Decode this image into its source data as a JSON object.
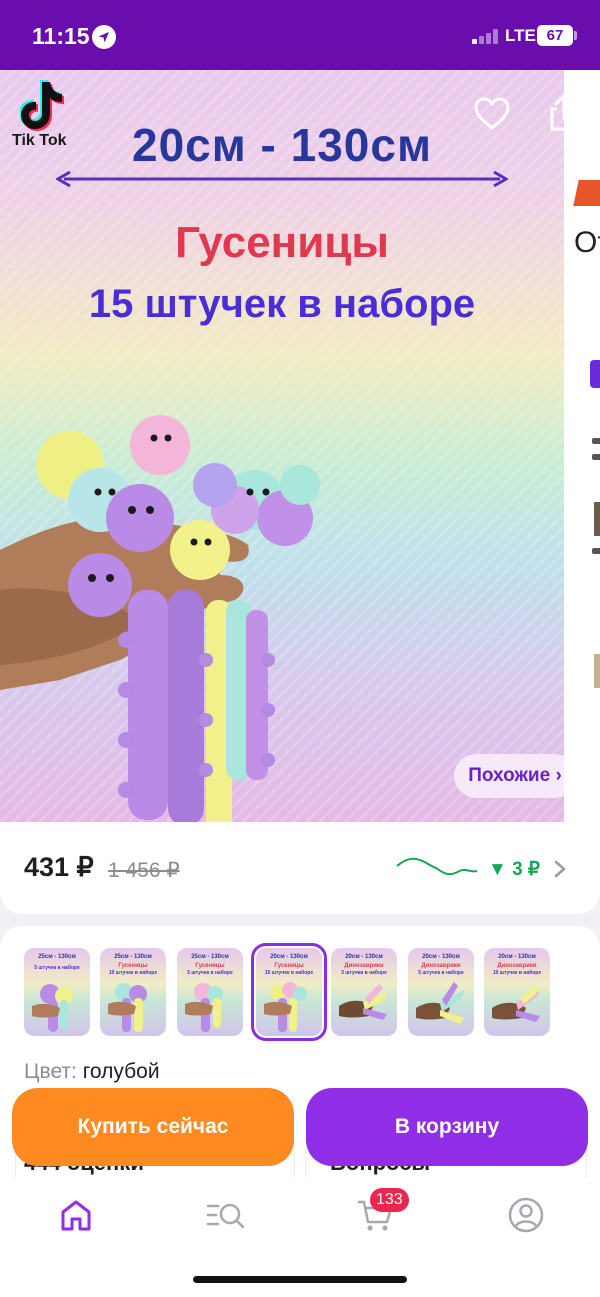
{
  "status_bar": {
    "time": "11:15",
    "network": "LTE",
    "battery": "67"
  },
  "product_image": {
    "brand_label": "Tik Tok",
    "size_range": "20см - 130см",
    "title": "Гусеницы",
    "set_count": "15 штучек в наборе",
    "similar_button": "Похожие ›",
    "icons": [
      "tiktok-logo-icon",
      "heart-icon",
      "share-icon"
    ]
  },
  "price": {
    "current": "431 ₽",
    "old": "1 456 ₽",
    "drop": "▼ 3 ₽"
  },
  "variants": {
    "thumbnails": [
      {
        "size": "25см - 130см",
        "name": "",
        "count": "5 штучек в наборе"
      },
      {
        "size": "25см - 130см",
        "name": "Гусеницы",
        "count": "10 штучек в наборе"
      },
      {
        "size": "25см - 130см",
        "name": "Гусеницы",
        "count": "5 штучек в наборе"
      },
      {
        "size": "20см - 130см",
        "name": "Гусеницы",
        "count": "15 штучек в наборе"
      },
      {
        "size": "20см - 130см",
        "name": "Динозаврики",
        "count": "3 штучки в наборе"
      },
      {
        "size": "20см - 130см",
        "name": "Динозаврики",
        "count": "5 штучек в наборе"
      },
      {
        "size": "20см - 130см",
        "name": "Динозаврики",
        "count": "10 штучек в наборе"
      }
    ],
    "selected_index": 3,
    "color_label": "Цвет:",
    "color_value": "голубой"
  },
  "peeks": {
    "reviews": "444 оценки",
    "questions": "Вопросы"
  },
  "actions": {
    "buy_now": "Купить сейчас",
    "add_to_cart": "В корзину"
  },
  "bottom_nav": {
    "cart_badge": "133",
    "items": [
      "home-icon",
      "catalog-search-icon",
      "cart-icon",
      "profile-icon"
    ]
  },
  "colors": {
    "status_bar": "#6a0dad",
    "buy_now": "#ff8a22",
    "cart": "#8f2ee6",
    "accent": "#8b2be2",
    "price_drop": "#14a854",
    "badge": "#f0254d"
  }
}
